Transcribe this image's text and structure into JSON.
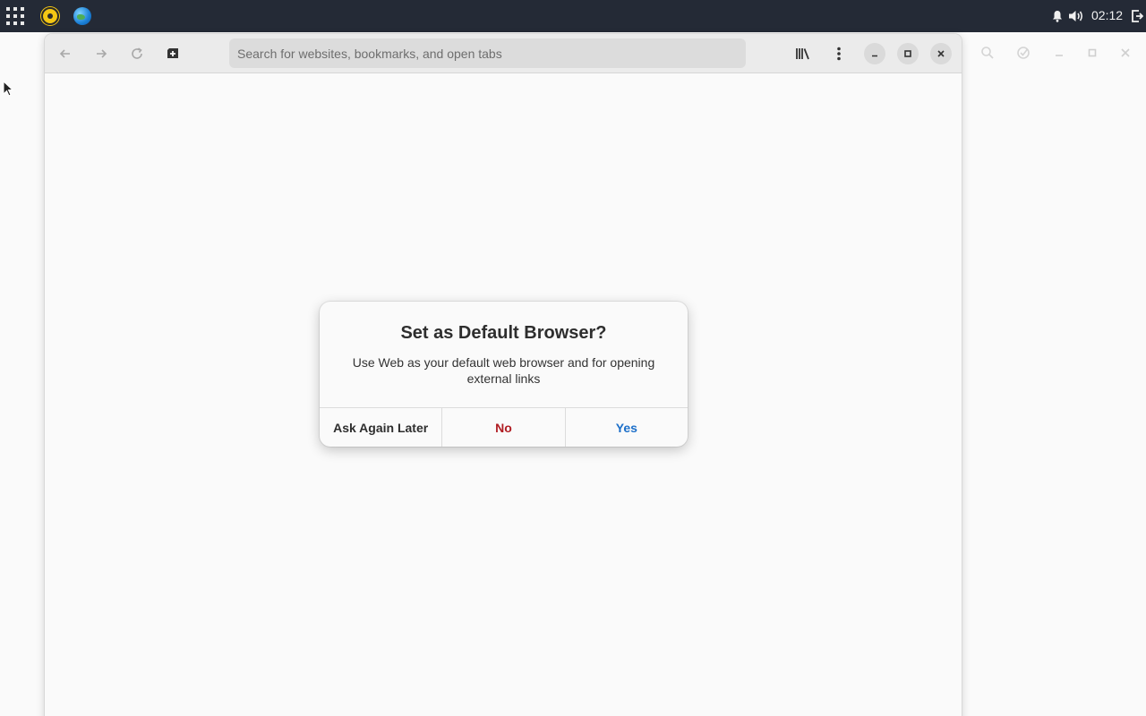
{
  "topbar": {
    "clock": "02:12",
    "apps": [
      {
        "name": "rhythmbox",
        "icon": "music-player-icon"
      },
      {
        "name": "web",
        "icon": "globe-icon"
      }
    ]
  },
  "browser": {
    "search_placeholder": "Search for websites, bookmarks, and open tabs",
    "search_value": ""
  },
  "dialog": {
    "title": "Set as Default Browser?",
    "body": "Use Web as your default web browser and for opening external links",
    "buttons": {
      "later": "Ask Again Later",
      "no": "No",
      "yes": "Yes"
    }
  },
  "colors": {
    "panel": "#242a36",
    "destructive": "#b01c22",
    "accent": "#1c6fc9"
  }
}
